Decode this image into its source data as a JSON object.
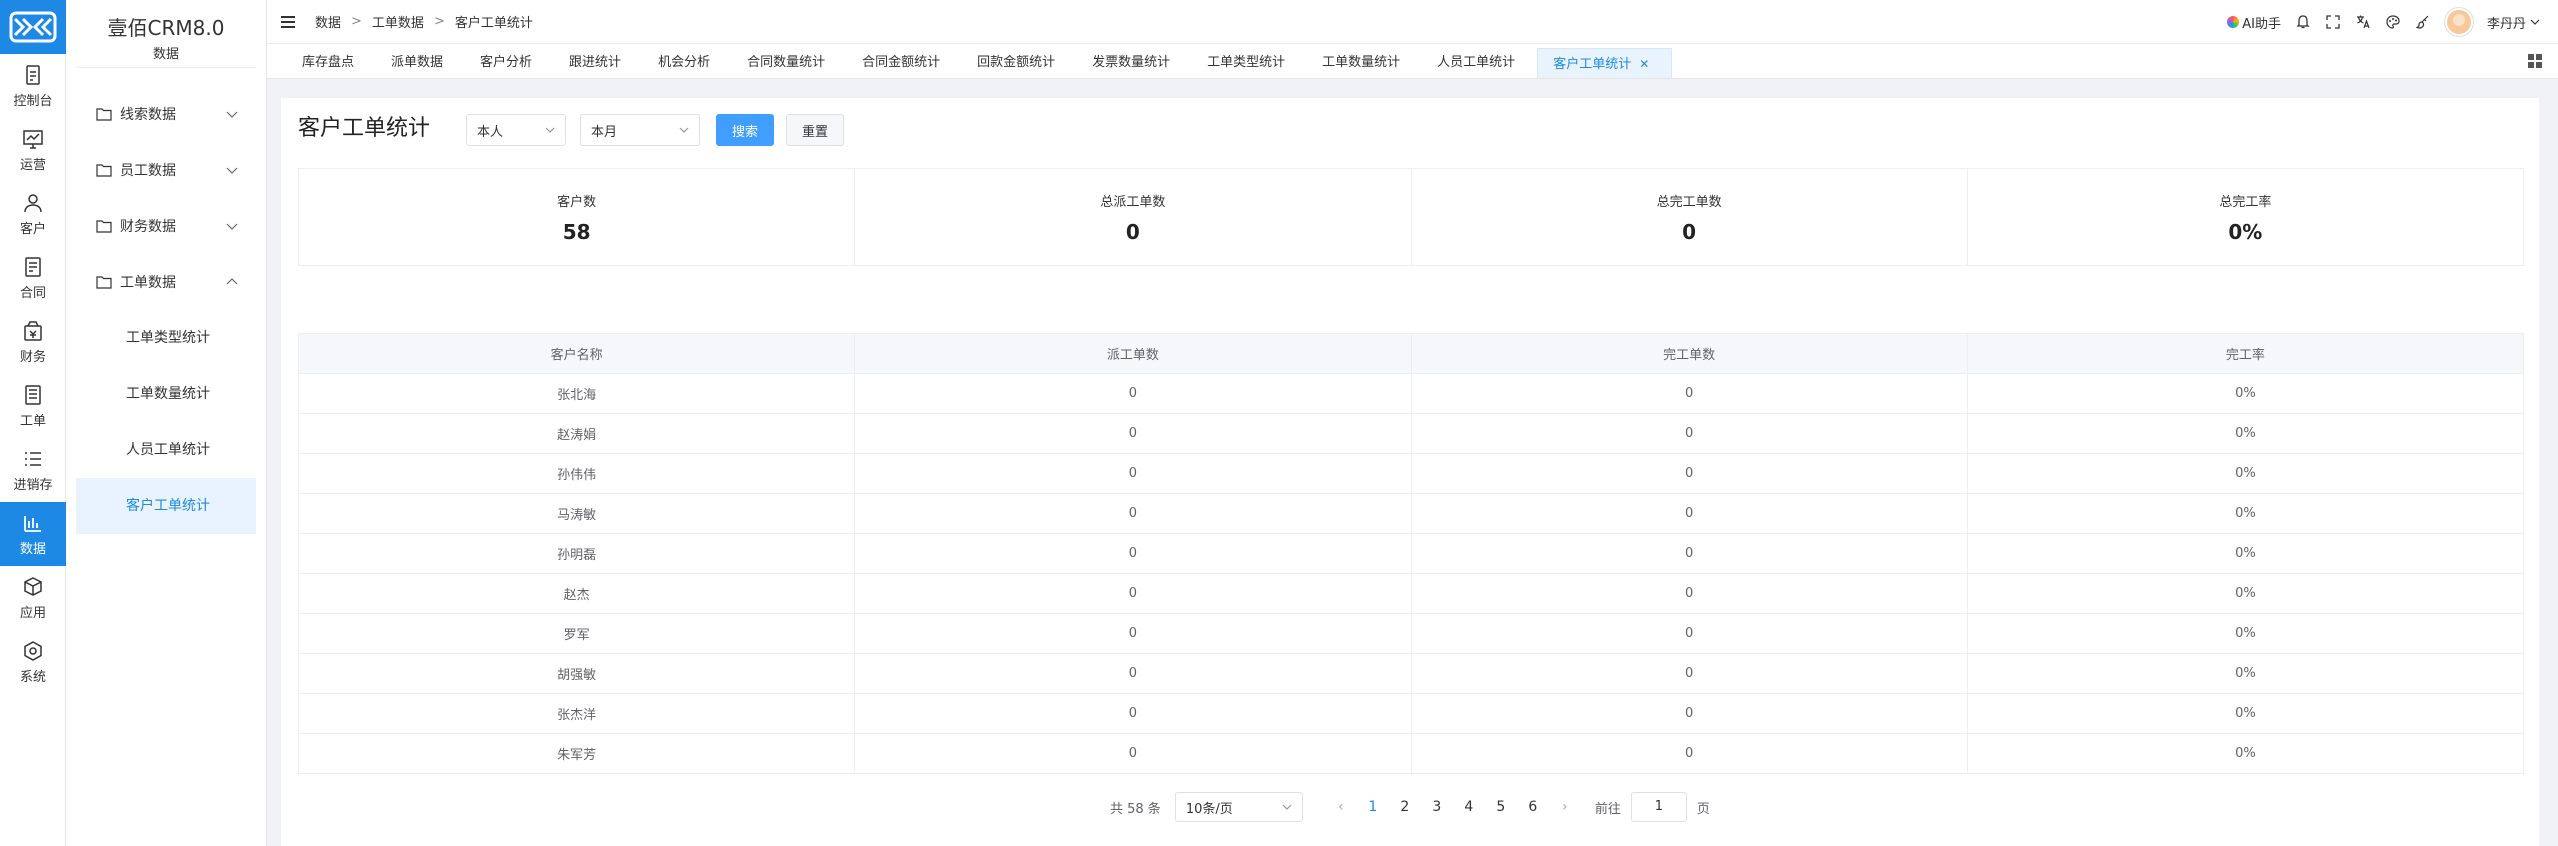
{
  "colors": {
    "accent": "#1e88e5",
    "primary_button": "#409eff"
  },
  "rail": {
    "items": [
      {
        "label": "控制台",
        "icon": "dashboard-icon"
      },
      {
        "label": "运营",
        "icon": "trend-chart-icon"
      },
      {
        "label": "客户",
        "icon": "user-icon"
      },
      {
        "label": "合同",
        "icon": "contract-icon"
      },
      {
        "label": "财务",
        "icon": "wallet-icon"
      },
      {
        "label": "工单",
        "icon": "ticket-icon"
      },
      {
        "label": "进销存",
        "icon": "list-icon"
      },
      {
        "label": "数据",
        "icon": "bar-chart-icon",
        "active": true
      },
      {
        "label": "应用",
        "icon": "cube-icon"
      },
      {
        "label": "系统",
        "icon": "hexagon-gear-icon"
      }
    ]
  },
  "sidebar": {
    "brand": "壹佰CRM8.0",
    "section": "数据",
    "groups": [
      {
        "label": "线索数据",
        "expanded": false
      },
      {
        "label": "员工数据",
        "expanded": false
      },
      {
        "label": "财务数据",
        "expanded": false
      },
      {
        "label": "工单数据",
        "expanded": true
      }
    ],
    "sub_items": [
      {
        "label": "工单类型统计"
      },
      {
        "label": "工单数量统计"
      },
      {
        "label": "人员工单统计"
      },
      {
        "label": "客户工单统计",
        "active": true
      }
    ]
  },
  "header": {
    "breadcrumb": [
      "数据",
      "工单数据",
      "客户工单统计"
    ],
    "separator": ">",
    "ai_label": "AI助手",
    "username": "李丹丹"
  },
  "tabs": [
    "库存盘点",
    "派单数据",
    "客户分析",
    "跟进统计",
    "机会分析",
    "合同数量统计",
    "合同金额统计",
    "回款金额统计",
    "发票数量统计",
    "工单类型统计",
    "工单数量统计",
    "人员工单统计",
    "客户工单统计"
  ],
  "active_tab": "客户工单统计",
  "page": {
    "title": "客户工单统计",
    "filter_person": "本人",
    "filter_period": "本月",
    "search_label": "搜索",
    "reset_label": "重置"
  },
  "stats": [
    {
      "label": "客户数",
      "value": "58"
    },
    {
      "label": "总派工单数",
      "value": "0"
    },
    {
      "label": "总完工单数",
      "value": "0"
    },
    {
      "label": "总完工率",
      "value": "0%"
    }
  ],
  "table": {
    "columns": [
      "客户名称",
      "派工单数",
      "完工单数",
      "完工率"
    ],
    "rows": [
      [
        "张北海",
        "0",
        "0",
        "0%"
      ],
      [
        "赵涛娟",
        "0",
        "0",
        "0%"
      ],
      [
        "孙伟伟",
        "0",
        "0",
        "0%"
      ],
      [
        "马涛敏",
        "0",
        "0",
        "0%"
      ],
      [
        "孙明磊",
        "0",
        "0",
        "0%"
      ],
      [
        "赵杰",
        "0",
        "0",
        "0%"
      ],
      [
        "罗军",
        "0",
        "0",
        "0%"
      ],
      [
        "胡强敏",
        "0",
        "0",
        "0%"
      ],
      [
        "张杰洋",
        "0",
        "0",
        "0%"
      ],
      [
        "朱军芳",
        "0",
        "0",
        "0%"
      ]
    ]
  },
  "pagination": {
    "total_text": "共 58 条",
    "page_size": "10条/页",
    "pages": [
      "1",
      "2",
      "3",
      "4",
      "5",
      "6"
    ],
    "current": "1",
    "goto_prefix": "前往",
    "goto_value": "1",
    "goto_suffix": "页"
  }
}
